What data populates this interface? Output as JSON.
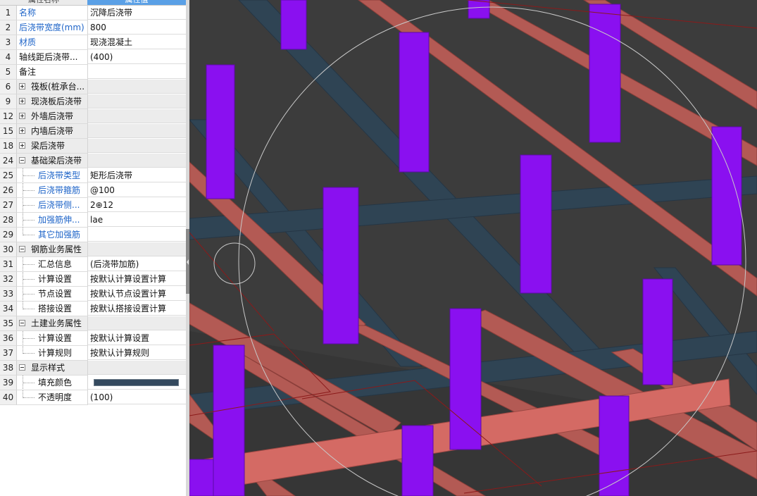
{
  "properties": {
    "header": {
      "name_col": "属性名称",
      "value_col": "属性值"
    },
    "rows": [
      {
        "num": "1",
        "name": "名称",
        "value": "沉降后浇带",
        "kind": "plain",
        "blue": true
      },
      {
        "num": "2",
        "name": "后浇带宽度(mm)",
        "value": "800",
        "kind": "plain",
        "blue": true
      },
      {
        "num": "3",
        "name": "材质",
        "value": "现浇混凝土",
        "kind": "plain",
        "blue": true
      },
      {
        "num": "4",
        "name": "轴线距后浇带...",
        "value": "(400)",
        "kind": "plain",
        "blue": false
      },
      {
        "num": "5",
        "name": "备注",
        "value": "",
        "kind": "plain",
        "blue": false
      },
      {
        "num": "6",
        "name": "筏板(桩承台...",
        "value": "",
        "kind": "group",
        "expanded": false
      },
      {
        "num": "9",
        "name": "现浇板后浇带",
        "value": "",
        "kind": "group",
        "expanded": false
      },
      {
        "num": "12",
        "name": "外墙后浇带",
        "value": "",
        "kind": "group",
        "expanded": false
      },
      {
        "num": "15",
        "name": "内墙后浇带",
        "value": "",
        "kind": "group",
        "expanded": false
      },
      {
        "num": "18",
        "name": "梁后浇带",
        "value": "",
        "kind": "group",
        "expanded": false
      },
      {
        "num": "24",
        "name": "基础梁后浇带",
        "value": "",
        "kind": "group",
        "expanded": true
      },
      {
        "num": "25",
        "name": "后浇带类型",
        "value": "矩形后浇带",
        "kind": "child",
        "blue": true
      },
      {
        "num": "26",
        "name": "后浇带箍筋",
        "value": "@100",
        "kind": "child",
        "blue": true
      },
      {
        "num": "27",
        "name": "后浇带侧...",
        "value": "2⊕12",
        "kind": "child",
        "blue": true
      },
      {
        "num": "28",
        "name": "加强筋伸...",
        "value": "lae",
        "kind": "child",
        "blue": true
      },
      {
        "num": "29",
        "name": "其它加强筋",
        "value": "",
        "kind": "child",
        "blue": true,
        "last": true
      },
      {
        "num": "30",
        "name": "钢筋业务属性",
        "value": "",
        "kind": "group",
        "expanded": true
      },
      {
        "num": "31",
        "name": "汇总信息",
        "value": "(后浇带加筋)",
        "kind": "child",
        "blue": false
      },
      {
        "num": "32",
        "name": "计算设置",
        "value": "按默认计算设置计算",
        "kind": "child",
        "blue": false
      },
      {
        "num": "33",
        "name": "节点设置",
        "value": "按默认节点设置计算",
        "kind": "child",
        "blue": false
      },
      {
        "num": "34",
        "name": "搭接设置",
        "value": "按默认搭接设置计算",
        "kind": "child",
        "blue": false,
        "last": true
      },
      {
        "num": "35",
        "name": "土建业务属性",
        "value": "",
        "kind": "group",
        "expanded": true
      },
      {
        "num": "36",
        "name": "计算设置",
        "value": "按默认计算设置",
        "kind": "child",
        "blue": false
      },
      {
        "num": "37",
        "name": "计算规则",
        "value": "按默认计算规则",
        "kind": "child",
        "blue": false,
        "last": true
      },
      {
        "num": "38",
        "name": "显示样式",
        "value": "",
        "kind": "group",
        "expanded": true
      },
      {
        "num": "39",
        "name": "填充颜色",
        "value": "",
        "kind": "child",
        "blue": false,
        "swatch": "#34495e"
      },
      {
        "num": "40",
        "name": "不透明度",
        "value": "(100)",
        "kind": "child",
        "blue": false,
        "last": true
      }
    ]
  },
  "colors": {
    "label_blue": "#1e64c8",
    "column_purple": "#8a10f0",
    "beam_salmon": "#c2635c",
    "band_blue": "#34495e",
    "background": "#3c3c3c"
  }
}
